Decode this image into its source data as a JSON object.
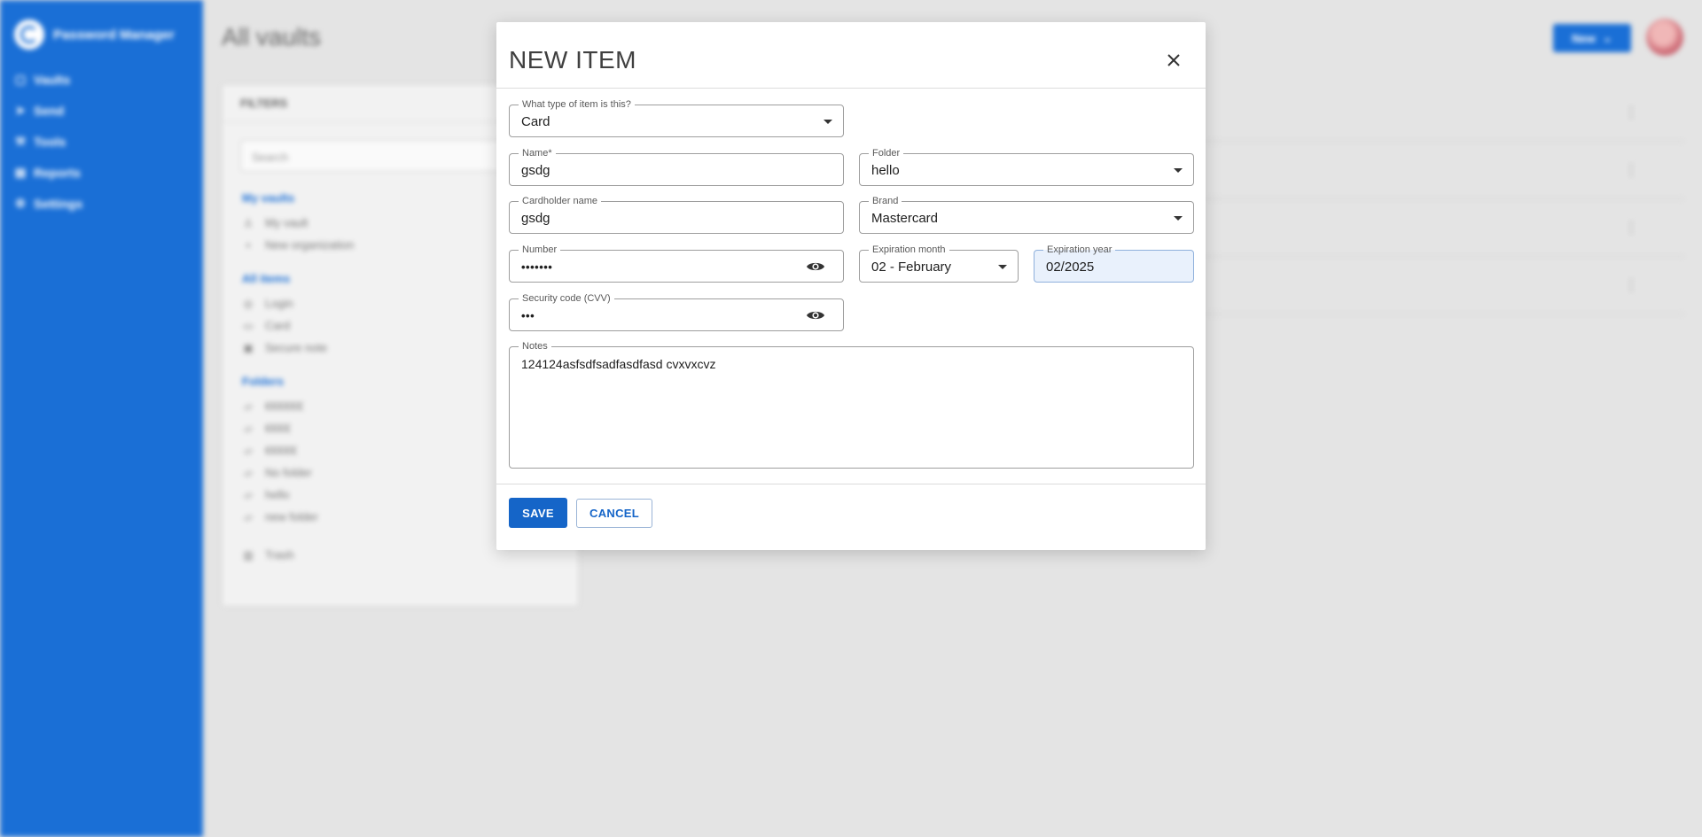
{
  "background": {
    "brand_name": "Password Manager",
    "nav": [
      {
        "icon": "vault-icon",
        "glyph": "▢",
        "label": "Vaults"
      },
      {
        "icon": "send-icon",
        "glyph": "➤",
        "label": "Send"
      },
      {
        "icon": "tools-icon",
        "glyph": "⚒",
        "label": "Tools"
      },
      {
        "icon": "reports-icon",
        "glyph": "▤",
        "label": "Reports"
      },
      {
        "icon": "settings-icon",
        "glyph": "⚙",
        "label": "Settings"
      }
    ],
    "page_title": "All vaults",
    "new_button": "New",
    "filters": {
      "title": "FILTERS",
      "search_placeholder": "Search",
      "sections": [
        {
          "label": "My vaults",
          "items": [
            "My vault",
            "New organization"
          ]
        },
        {
          "label": "All items",
          "items": [
            "Login",
            "Card",
            "Secure note"
          ]
        },
        {
          "label": "Folders",
          "items": [
            "€€€€€€",
            "€€€€",
            "€€€€€",
            "No folder",
            "hello",
            "new folder"
          ]
        }
      ],
      "trash": "Trash"
    }
  },
  "dialog": {
    "title": "NEW ITEM",
    "fields": {
      "type": {
        "label": "What type of item is this?",
        "value": "Card"
      },
      "name": {
        "label": "Name*",
        "value": "gsdg"
      },
      "folder": {
        "label": "Folder",
        "value": "hello"
      },
      "cardholder": {
        "label": "Cardholder name",
        "value": "gsdg"
      },
      "brand": {
        "label": "Brand",
        "value": "Mastercard"
      },
      "number": {
        "label": "Number",
        "value": "•••••••"
      },
      "exp_month": {
        "label": "Expiration month",
        "value": "02 - February"
      },
      "exp_year": {
        "label": "Expiration year",
        "value": "02/2025"
      },
      "cvv": {
        "label": "Security code (CVV)",
        "value": "•••"
      },
      "notes": {
        "label": "Notes",
        "value": "124124asfsdfsadfasdfasd cvxvxcvz"
      }
    },
    "save_label": "SAVE",
    "cancel_label": "CANCEL"
  },
  "colors": {
    "accent": "#1565c8",
    "sidebar": "#1a6fd6"
  }
}
